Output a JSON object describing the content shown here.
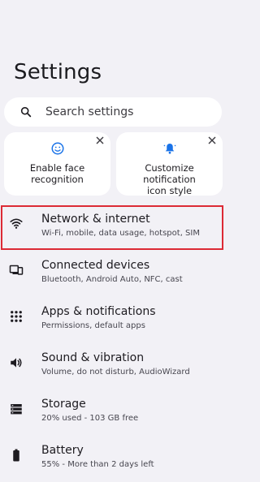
{
  "page": {
    "title": "Settings"
  },
  "search": {
    "placeholder": "Search settings",
    "icon": "search-icon"
  },
  "suggestions": [
    {
      "label_line1": "Enable face",
      "label_line2": "recognition",
      "icon": "face-icon"
    },
    {
      "label_line1": "Customize notification",
      "label_line2": "icon style",
      "icon": "notification-bell-icon"
    }
  ],
  "accent_color": "#1a73e8",
  "highlight_color": "#dc2a35",
  "items": [
    {
      "title": "Network & internet",
      "subtitle": "Wi-Fi, mobile, data usage, hotspot, SIM",
      "icon": "wifi-icon",
      "highlighted": true
    },
    {
      "title": "Connected devices",
      "subtitle": "Bluetooth, Android Auto, NFC, cast",
      "icon": "connected-devices-icon"
    },
    {
      "title": "Apps & notifications",
      "subtitle": "Permissions, default apps",
      "icon": "apps-grid-icon"
    },
    {
      "title": "Sound & vibration",
      "subtitle": "Volume, do not disturb, AudioWizard",
      "icon": "volume-icon"
    },
    {
      "title": "Storage",
      "subtitle": "20% used - 103 GB free",
      "icon": "storage-icon"
    },
    {
      "title": "Battery",
      "subtitle": "55% - More than 2 days left",
      "icon": "battery-icon"
    }
  ]
}
